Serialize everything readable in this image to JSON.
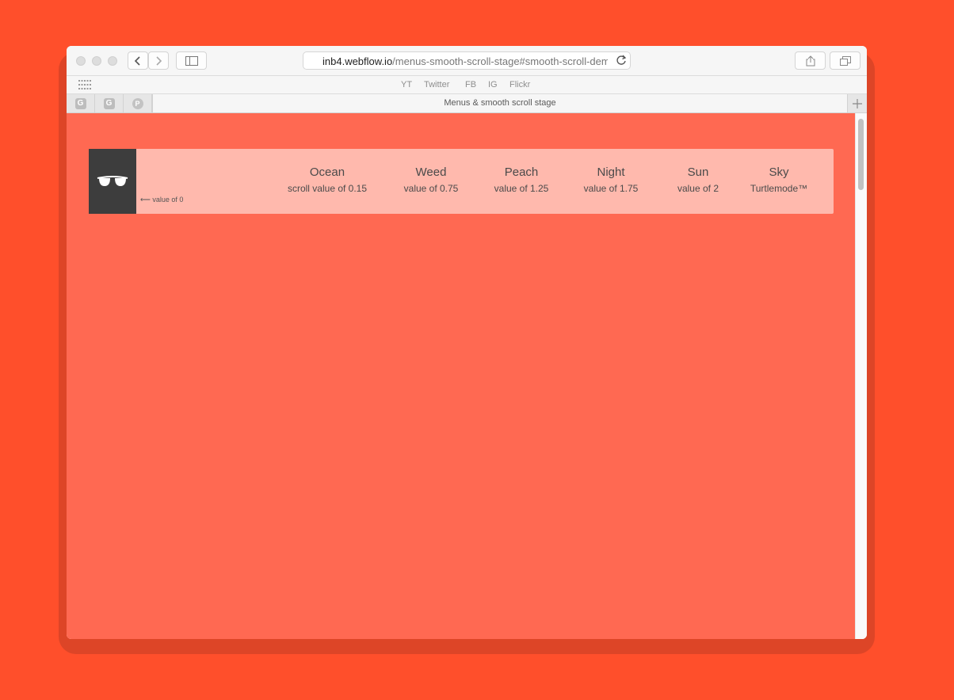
{
  "browser": {
    "url_host": "inb4.webflow.io",
    "url_path": "/menus-smooth-scroll-stage#smooth-scroll-dem",
    "favorites": [
      "YT",
      "Twitter",
      "FB",
      "IG",
      "Flickr"
    ],
    "pinned_tabs": [
      "G",
      "G",
      "P"
    ],
    "active_tab_title": "Menus & smooth scroll stage"
  },
  "page": {
    "zero_label": "value of 0",
    "nav_items": [
      {
        "name": "Ocean",
        "value": "scroll value of 0.15"
      },
      {
        "name": "Weed",
        "value": "value of 0.75"
      },
      {
        "name": "Peach",
        "value": "value of 1.25"
      },
      {
        "name": "Night",
        "value": "value of 1.75"
      },
      {
        "name": "Sun",
        "value": "value of 2"
      },
      {
        "name": "Sky",
        "value": "Turtlemode™"
      }
    ]
  },
  "colors": {
    "desktop": "#ff4f2b",
    "page_background": "#ff6952",
    "nav_background": "#ffb9ad",
    "logo_background": "#3d3d3d"
  }
}
